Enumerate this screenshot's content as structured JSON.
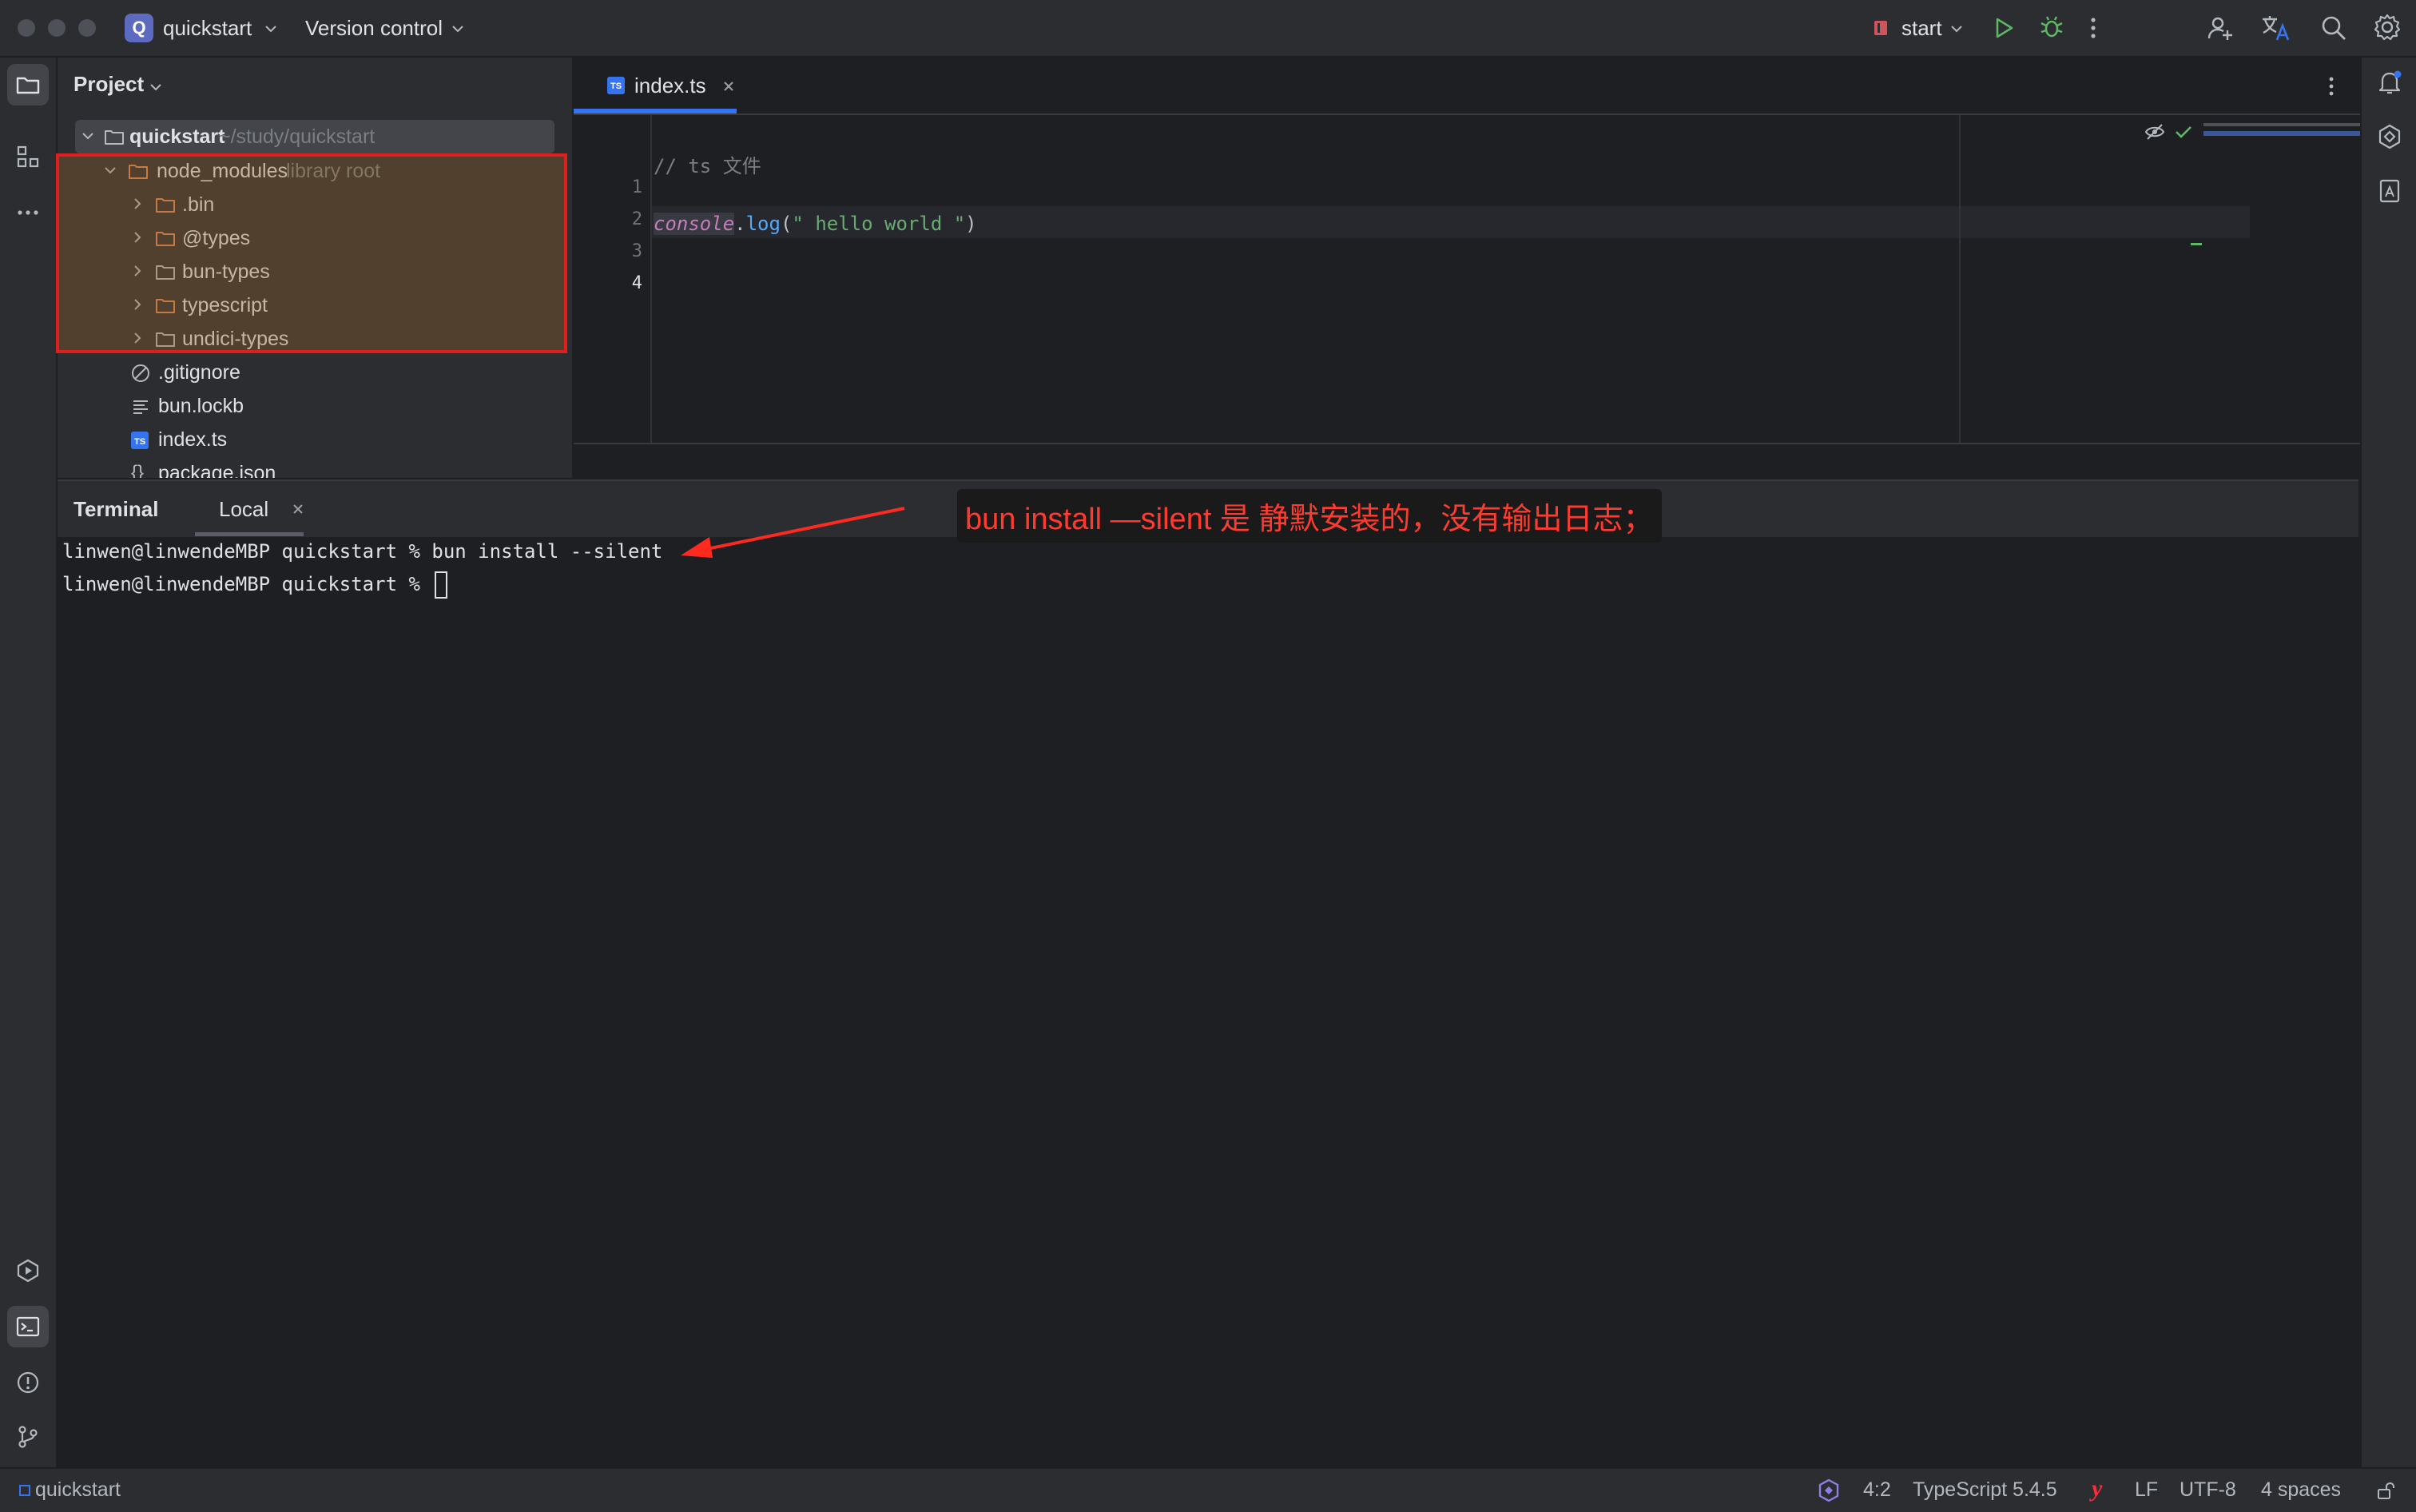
{
  "titlebar": {
    "project_badge": "Q",
    "project_name": "quickstart",
    "version_control": "Version control",
    "run_config": "start"
  },
  "project_panel": {
    "title": "Project",
    "root": {
      "name": "quickstart",
      "path": "~/study/quickstart"
    },
    "node_modules": {
      "name": "node_modules",
      "hint": "library root"
    },
    "node_modules_children": [
      ".bin",
      "@types",
      "bun-types",
      "typescript",
      "undici-types"
    ],
    "files": [
      ".gitignore",
      "bun.lockb",
      "index.ts",
      "package.json"
    ]
  },
  "editor": {
    "tab_label": "index.ts",
    "tab_badge": "TS",
    "line_numbers": [
      "1",
      "2",
      "3",
      "4"
    ],
    "lines": {
      "l2_comment": "// ts 文件",
      "l4_obj": "console",
      "l4_dot": ".",
      "l4_method": "log",
      "l4_open": "(",
      "l4_str": "\" hello world \"",
      "l4_close": ")"
    }
  },
  "terminal": {
    "title": "Terminal",
    "tab_local": "Local",
    "line1": "linwen@linwendeMBP quickstart % bun install --silent",
    "line2_prompt": "linwen@linwendeMBP quickstart % "
  },
  "annotation": {
    "text": "bun install —silent 是 静默安装的，没有输出日志；",
    "color": "#ff3b30"
  },
  "statusbar": {
    "project": "quickstart",
    "position": "4:2",
    "language": "TypeScript 5.4.5",
    "line_ending": "LF",
    "encoding": "UTF-8",
    "indent": "4 spaces"
  },
  "colors": {
    "accent": "#3574f0",
    "highlight_border": "#e01e1e",
    "run_green": "#5fb865",
    "keyword_purple": "#c77dbb",
    "string_green": "#6aab73",
    "method_blue": "#56a8f5"
  }
}
